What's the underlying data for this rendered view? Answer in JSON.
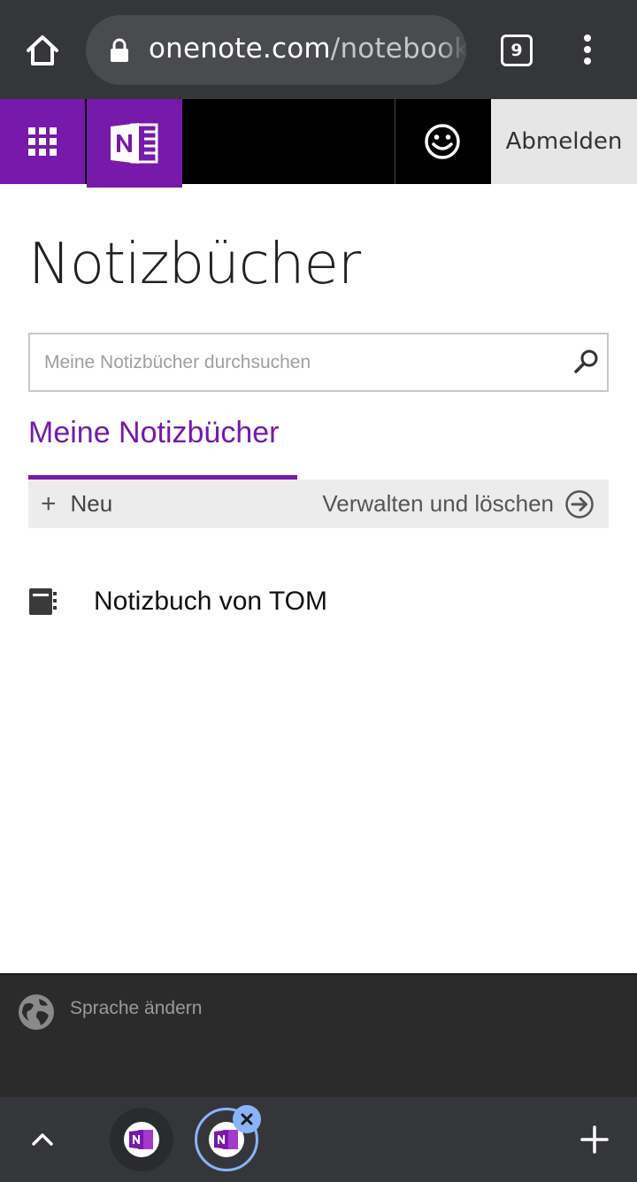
{
  "browser": {
    "url_host": "onenote.com",
    "url_path": "/notebooks",
    "tab_count": "9"
  },
  "header": {
    "signout_label": "Abmelden"
  },
  "page": {
    "title": "Notizbücher",
    "search_placeholder": "Meine Notizbücher durchsuchen",
    "section_tab": "Meine Notizbücher",
    "new_label": "Neu",
    "manage_label": "Verwalten und löschen",
    "notebooks": [
      {
        "name": "Notizbuch von TOM"
      }
    ]
  },
  "footer": {
    "language_label": "Sprache ändern"
  },
  "colors": {
    "brand": "#7719aa",
    "browser_chrome": "#35363a",
    "tab_active_ring": "#8ab4f8"
  },
  "icons": {
    "home": "home-icon",
    "lock": "lock-icon",
    "menu": "more-vert-icon",
    "launcher": "app-launcher-icon",
    "onenote": "onenote-logo",
    "feedback": "smiley-icon",
    "search": "search-icon",
    "add": "plus-icon",
    "manage": "arrow-right-circle-icon",
    "notebook": "notebook-icon",
    "language": "globe-icon"
  }
}
